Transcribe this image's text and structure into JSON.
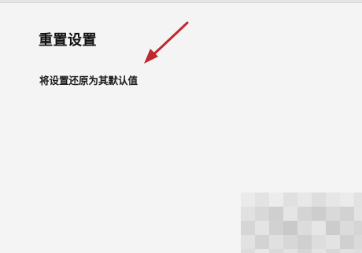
{
  "settings": {
    "section_title": "重置设置",
    "reset_link_label": "将设置还原为其默认值"
  },
  "colors": {
    "background": "#f4f4f4",
    "annotation_arrow": "#c0282d",
    "text": "#1a1a1a"
  },
  "icons": {
    "annotation": "red-arrow-icon"
  }
}
